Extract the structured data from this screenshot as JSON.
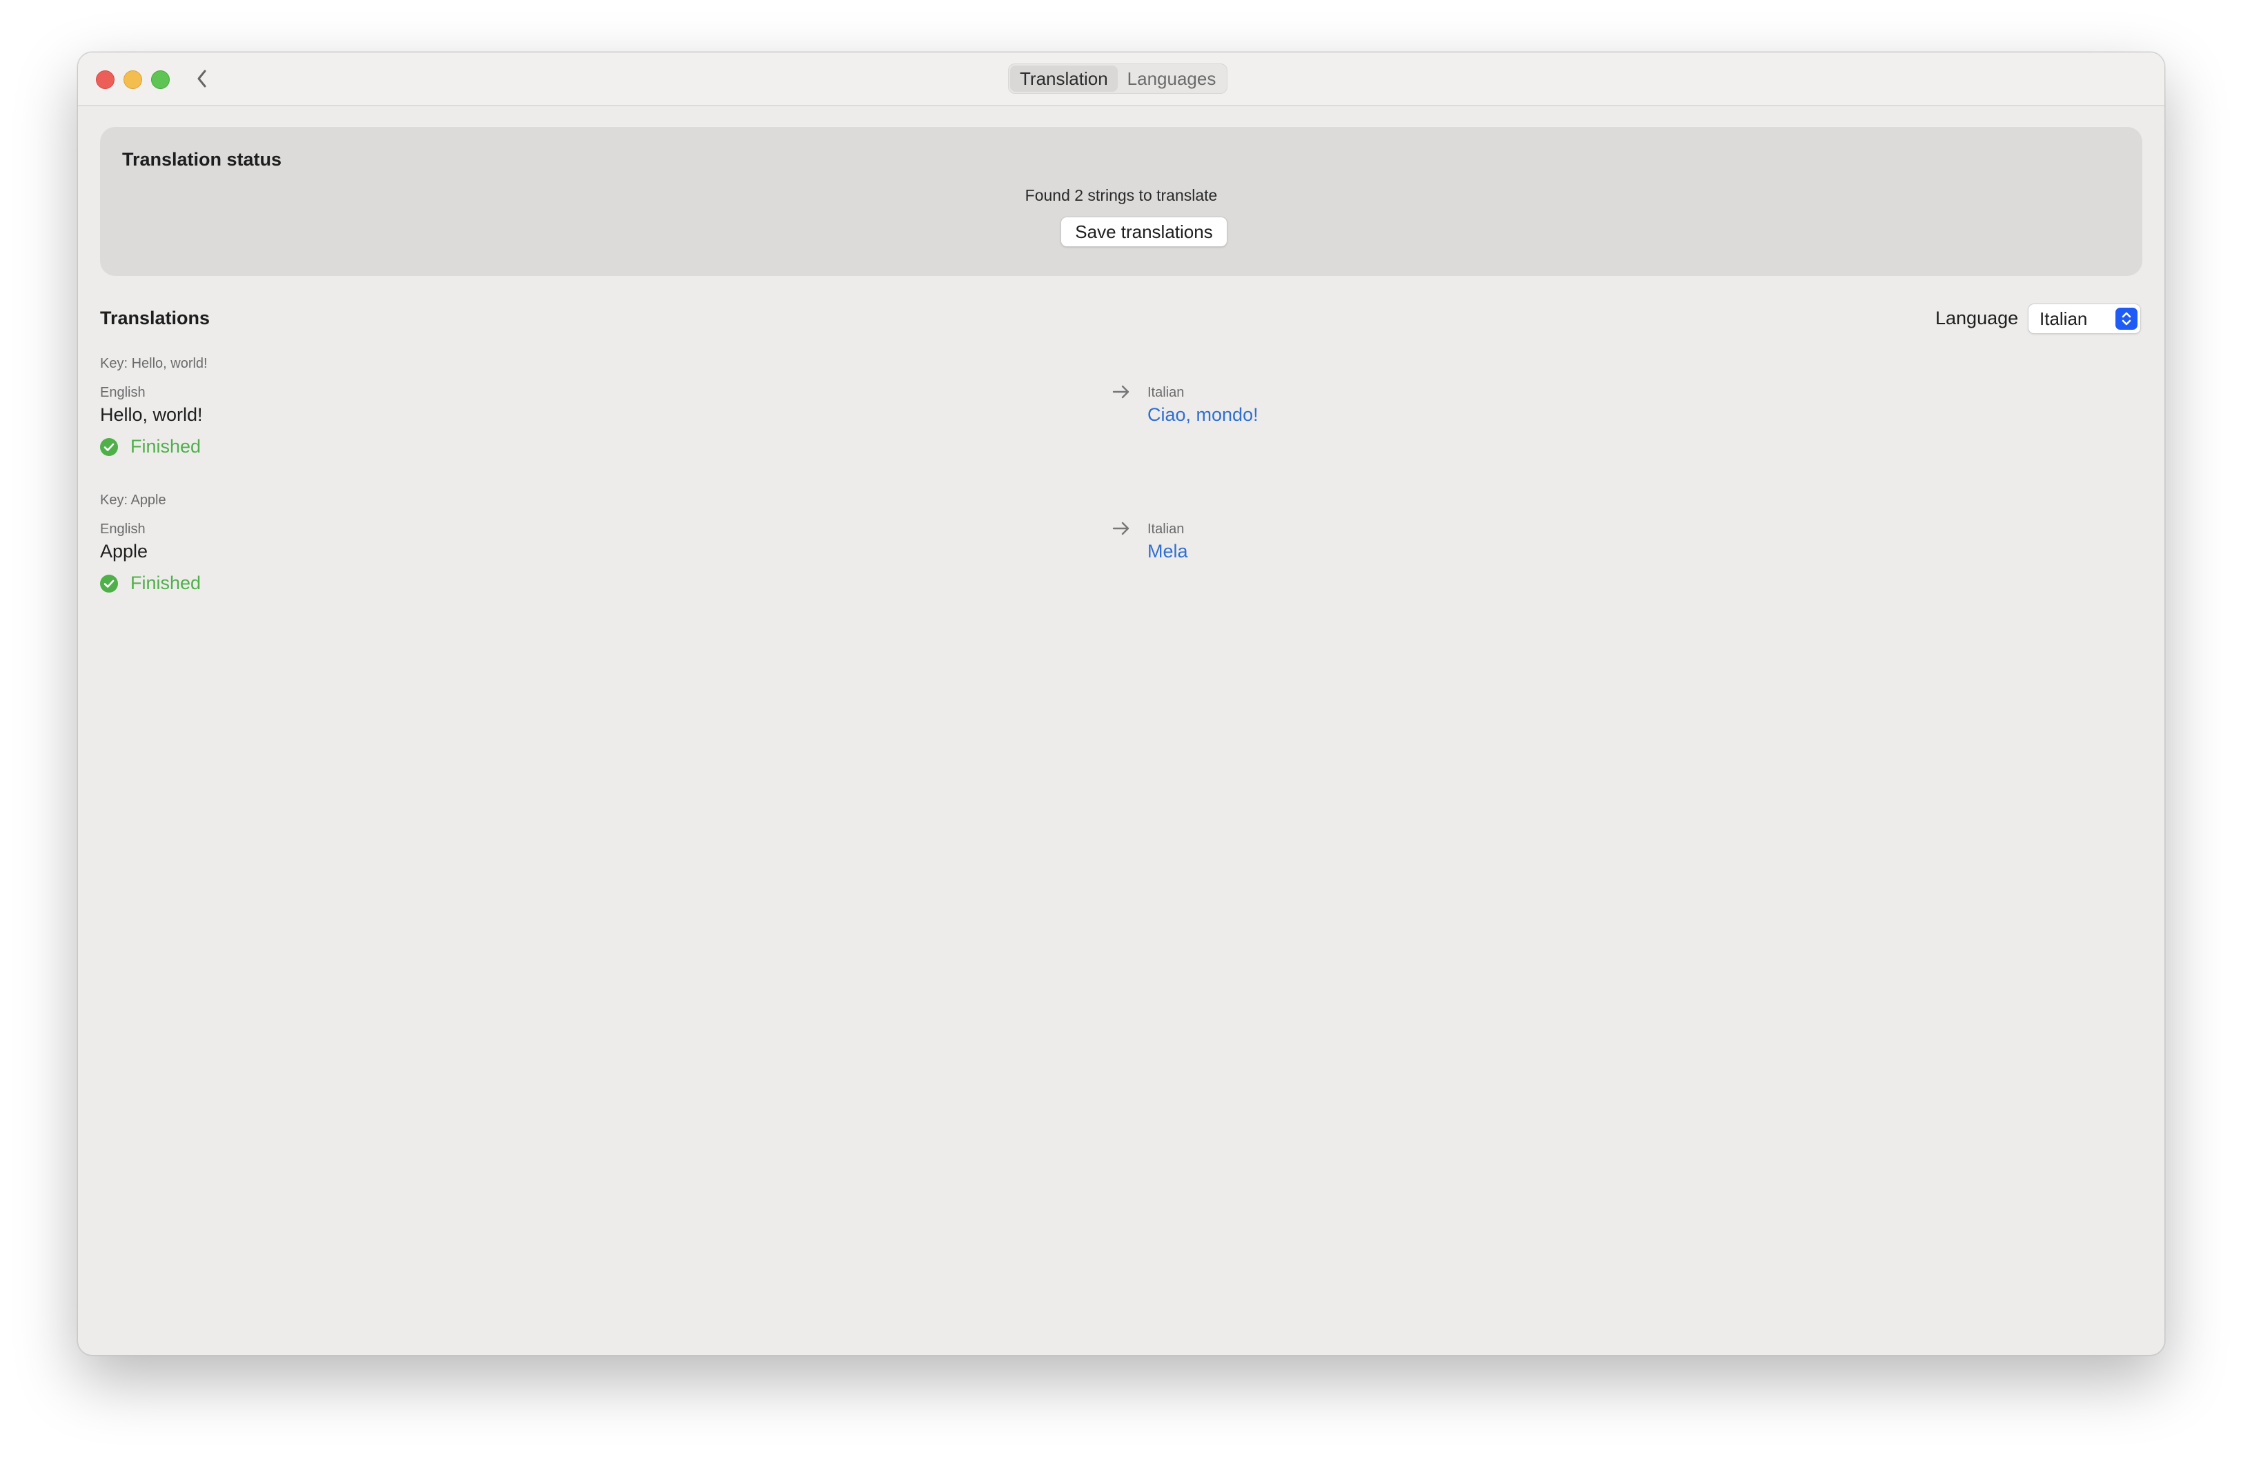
{
  "toolbar": {
    "tabs": [
      {
        "label": "Translation",
        "active": true
      },
      {
        "label": "Languages",
        "active": false
      }
    ]
  },
  "status_panel": {
    "title": "Translation status",
    "message": "Found 2 strings to translate",
    "save_label": "Save translations"
  },
  "translations": {
    "title": "Translations",
    "language_label": "Language",
    "language_value": "Italian",
    "items": [
      {
        "key": "Key: Hello, world!",
        "source_lang": "English",
        "source_text": "Hello, world!",
        "target_lang": "Italian",
        "target_text": "Ciao, mondo!",
        "status": "Finished"
      },
      {
        "key": "Key: Apple",
        "source_lang": "English",
        "source_text": "Apple",
        "target_lang": "Italian",
        "target_text": "Mela",
        "status": "Finished"
      }
    ]
  },
  "colors": {
    "accent": "#1f5bf5",
    "translated_text": "#2f6fd1",
    "finished": "#4fb04a"
  }
}
